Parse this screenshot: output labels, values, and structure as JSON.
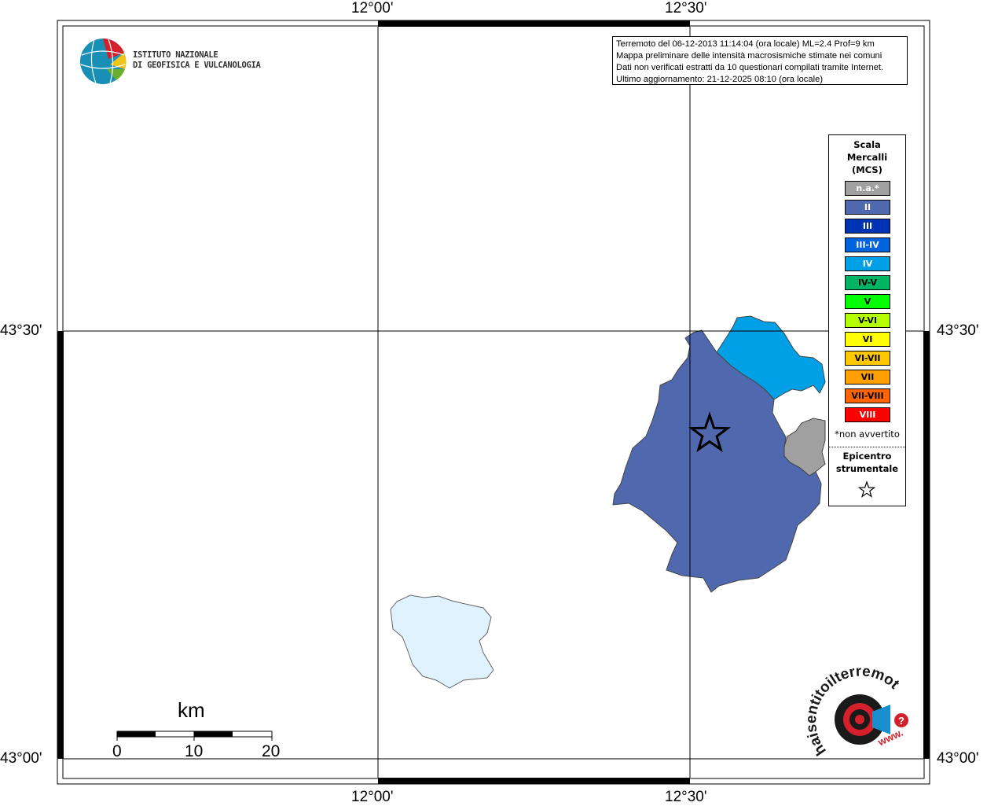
{
  "map": {
    "ticks": {
      "top": [
        "12°00'",
        "12°30'"
      ],
      "bottom": [
        "12°00'",
        "12°30'"
      ],
      "left": [
        "43°30'",
        "43°00'"
      ],
      "right": [
        "43°30'",
        "43°00'"
      ]
    },
    "regions": [
      {
        "name": "region-intensity-ii",
        "intensity": "II",
        "color": "#5068ad"
      },
      {
        "name": "region-intensity-iv",
        "intensity": "IV",
        "color": "#00a0e6"
      },
      {
        "name": "region-na",
        "intensity": "n.a.*",
        "color": "#a0a0a0"
      },
      {
        "name": "lake",
        "color": "#e0f2fd"
      }
    ]
  },
  "info": {
    "line1": "Terremoto del 06-12-2013 11:14:04 (ora locale) ML=2.4 Prof=9 km",
    "line2": "Mappa preliminare delle intensità macrosismiche stimate nei comuni",
    "line3": "Dati non verificati estratti da 10 questionari compilati tramite Internet.",
    "line4": "Ultimo aggiornamento: 21-12-2025 08:10 (ora locale)"
  },
  "legend": {
    "title1": "Scala",
    "title2": "Mercalli",
    "title3": "(MCS)",
    "items": [
      {
        "label": "n.a.*",
        "color": "#a0a0a0",
        "text": "#ffffff"
      },
      {
        "label": "II",
        "color": "#5068ad",
        "text": "#ffffff"
      },
      {
        "label": "III",
        "color": "#0032b4",
        "text": "#ffffff"
      },
      {
        "label": "III-IV",
        "color": "#0064dc",
        "text": "#ffffff"
      },
      {
        "label": "IV",
        "color": "#00a0e6",
        "text": "#ffffff"
      },
      {
        "label": "IV-V",
        "color": "#00b464",
        "text": "#000000"
      },
      {
        "label": "V",
        "color": "#00ff00",
        "text": "#000000"
      },
      {
        "label": "V-VI",
        "color": "#b4ff00",
        "text": "#000000"
      },
      {
        "label": "VI",
        "color": "#ffff00",
        "text": "#000000"
      },
      {
        "label": "VI-VII",
        "color": "#ffc800",
        "text": "#000000"
      },
      {
        "label": "VII",
        "color": "#ffa000",
        "text": "#000000"
      },
      {
        "label": "VII-VIII",
        "color": "#ff6400",
        "text": "#000000"
      },
      {
        "label": "VIII",
        "color": "#ff0000",
        "text": "#ffffff"
      }
    ],
    "note": "*non avvertito",
    "epi1": "Epicentro",
    "epi2": "strumentale",
    "epi_symbol": "star-icon"
  },
  "logo": {
    "line1": "ISTITUTO NAZIONALE",
    "line2": "DI GEOFISICA E VULCANOLOGIA"
  },
  "scalebar": {
    "title": "km",
    "labels": [
      "0",
      "10",
      "20"
    ]
  },
  "badge": {
    "text": "haisentitoilterremoto.it",
    "www": "www.",
    "icon": "question-icon"
  }
}
